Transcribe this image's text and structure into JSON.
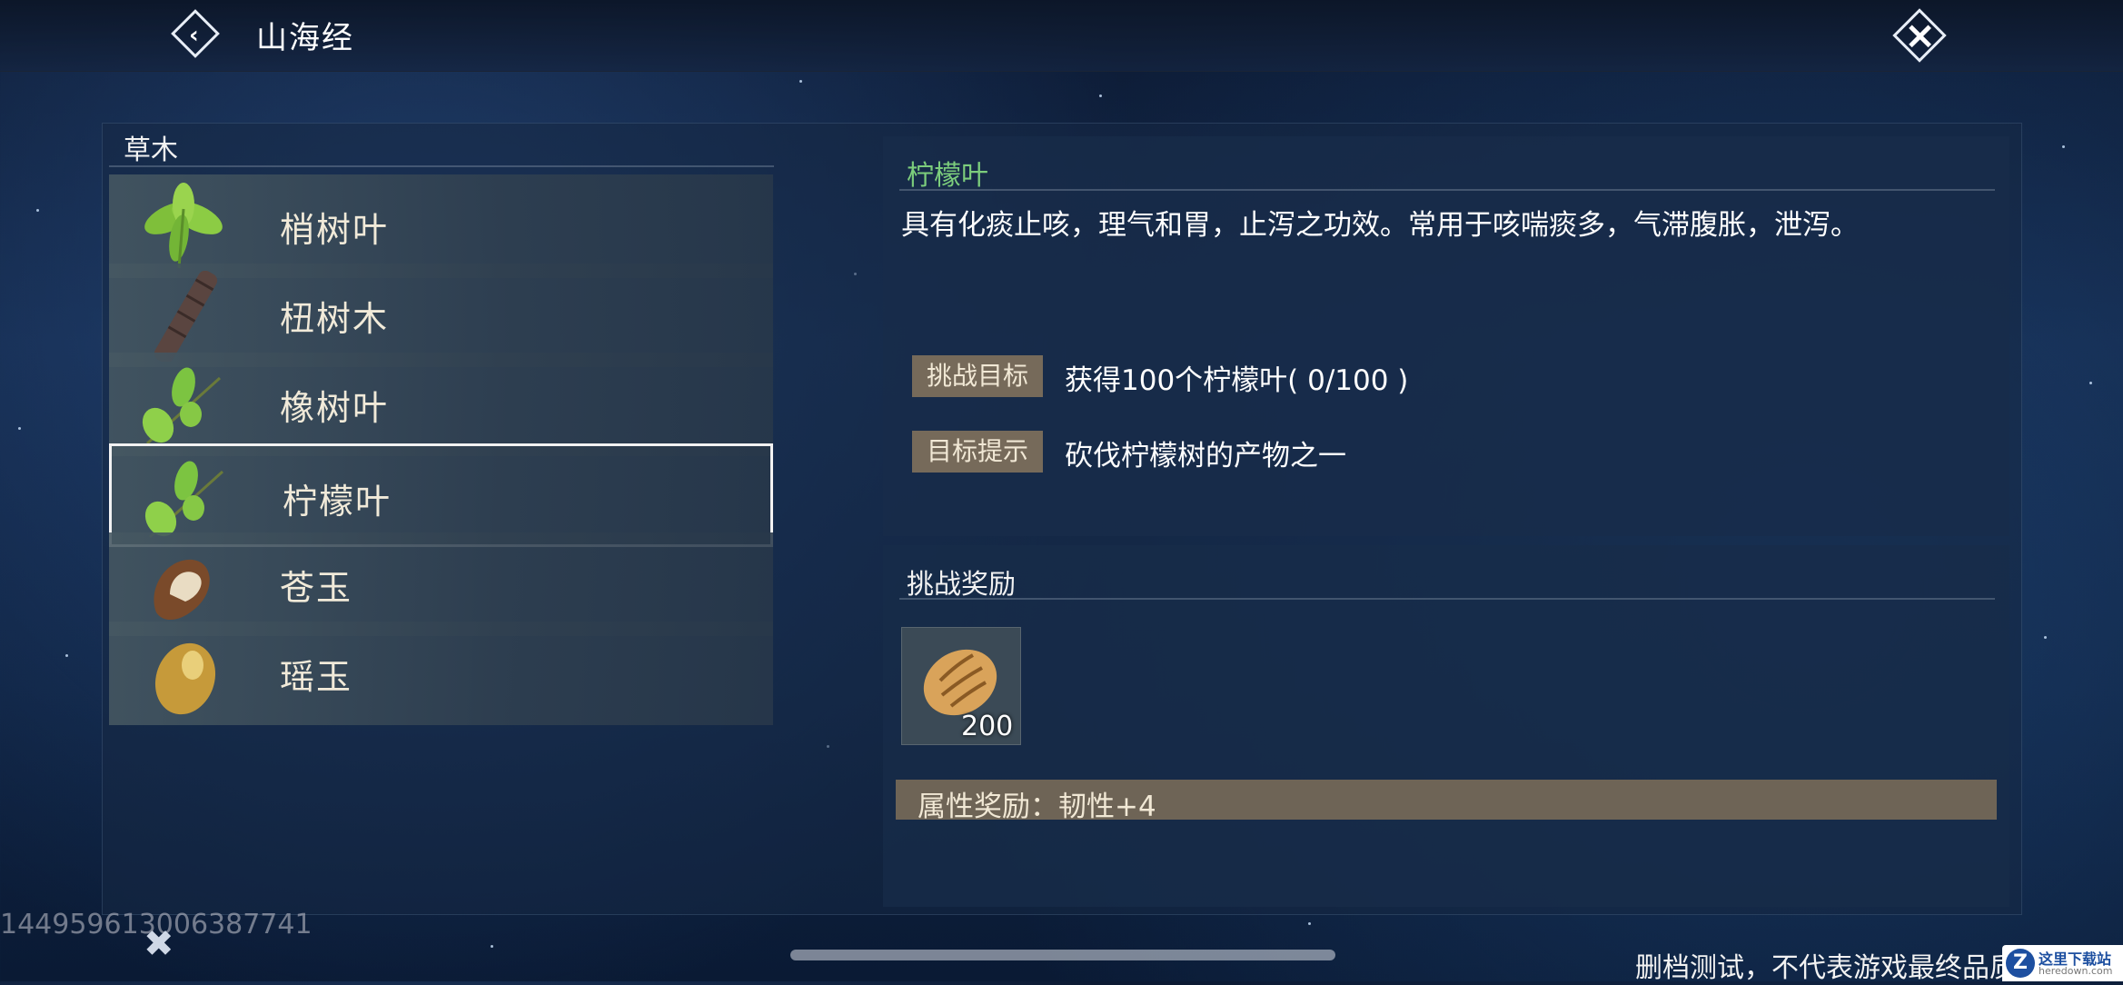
{
  "header": {
    "title": "山海经"
  },
  "category": {
    "label": "草木"
  },
  "items": [
    {
      "name": "梢树叶",
      "icon": "basil-leaf-icon"
    },
    {
      "name": "杻树木",
      "icon": "wood-log-icon"
    },
    {
      "name": "橡树叶",
      "icon": "leaf-sprig-icon"
    },
    {
      "name": "柠檬叶",
      "icon": "leaf-sprig-icon",
      "selected": true
    },
    {
      "name": "苍玉",
      "icon": "jade-stone-icon"
    },
    {
      "name": "瑶玉",
      "icon": "gold-stone-icon"
    }
  ],
  "detail": {
    "name": "柠檬叶",
    "description": "具有化痰止咳，理气和胃，止泻之功效。常用于咳喘痰多，气滞腹胀，泄泻。",
    "goal_label": "挑战目标",
    "goal_value": "获得100个柠檬叶( 0/100 )",
    "hint_label": "目标提示",
    "hint_value": "砍伐柠檬树的产物之一"
  },
  "reward": {
    "title": "挑战奖励",
    "item_icon": "bread-icon",
    "item_count": "200",
    "attribute": "属性奖励：韧性+4"
  },
  "footer": {
    "uid": "144959613006387741",
    "disclaimer": "删档测试，不代表游戏最终品质",
    "watermark_title": "这里下载站",
    "watermark_url": "heredown.com"
  },
  "colors": {
    "item_name": "#f1ead9",
    "detail_name": "#7ccd7c",
    "tag_bg": "#766a5a",
    "attr_bg": "#6e6456"
  }
}
